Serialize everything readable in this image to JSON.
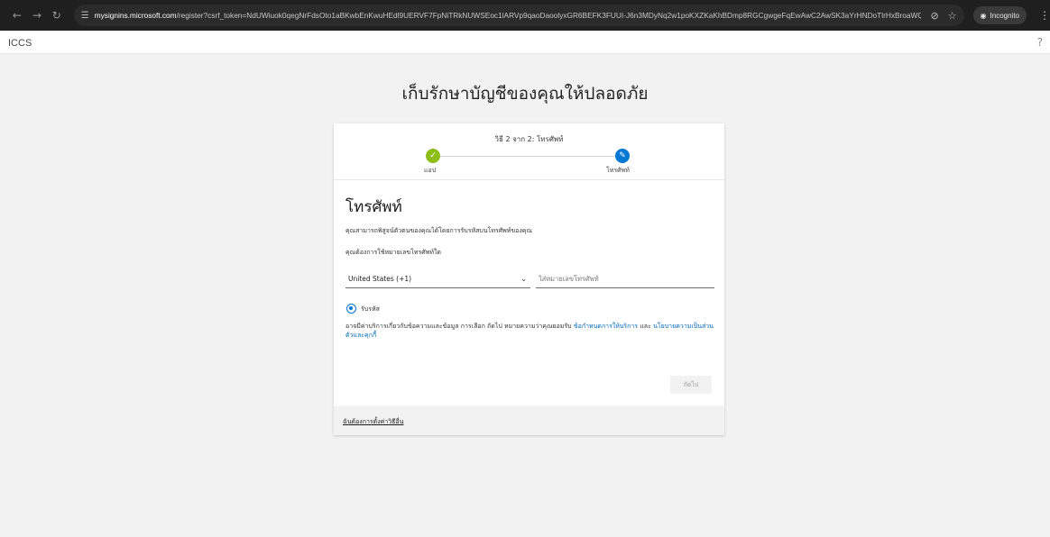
{
  "browser": {
    "url_host": "mysignins.microsoft.com",
    "url_path": "/register?csrf_token=NdUWiuok0qegNrFdsOto1aBKwbEnKwuHEdl9UERVF7FpNiTRkNUWSEoc1lARVp9qaoDaoolyxGR6BEFK3FUUI-J6n3MDyNq2w1poKXZKaKhBDmp8RGCgwgeFqEwAwC2AwSK3aYrHNDoTlrHxBroaWQ2&sso0...",
    "incognito_label": "Incognito",
    "icons": {
      "back": "back-arrow-icon",
      "forward": "forward-arrow-icon",
      "reload": "reload-icon",
      "site_info": "site-info-icon",
      "eye_off": "eye-off-icon",
      "bookmark": "star-icon",
      "incognito": "incognito-icon",
      "menu": "kebab-menu-icon"
    }
  },
  "header": {
    "brand": "ICCS",
    "help": "?"
  },
  "page": {
    "heading": "เก็บรักษาบัญชีของคุณให้ปลอดภัย"
  },
  "progress": {
    "caption": "วิธี 2 จาก 2: โทรศัพท์",
    "steps": [
      {
        "label": "แอป",
        "status": "complete",
        "icon": "checkmark-icon"
      },
      {
        "label": "โทรศัพท์",
        "status": "current",
        "icon": "pencil-icon"
      }
    ]
  },
  "form": {
    "title": "โทรศัพท์",
    "description": "คุณสามารถพิสูจน์ตัวตนของคุณได้โดยการรับรหัสบนโทรศัพท์ของคุณ",
    "question": "คุณต้องการใช้หมายเลขโทรศัพท์ใด",
    "country_select": "United States (+1)",
    "phone_placeholder": "ใส่หมายเลขโทรศัพท์",
    "radio_option": "รับรหัส",
    "legal_text": "อาจมีค่าบริการเกี่ยวกับข้อความและข้อมูล การเลือก ถัดไป หมายความว่าคุณยอมรับ",
    "terms_link": "ข้อกำหนดการให้บริการ",
    "and": "และ",
    "privacy_link": "นโยบายความเป็นส่วนตัวและคุกกี้",
    "next_button": "ถัดไป"
  },
  "footer": {
    "alt_method_link": "ฉันต้องการตั้งค่าวิธีอื่น"
  },
  "colors": {
    "accent": "#0078d4",
    "success": "#8cbd18",
    "link": "#0067b8",
    "page_bg": "#f2f2f2"
  }
}
